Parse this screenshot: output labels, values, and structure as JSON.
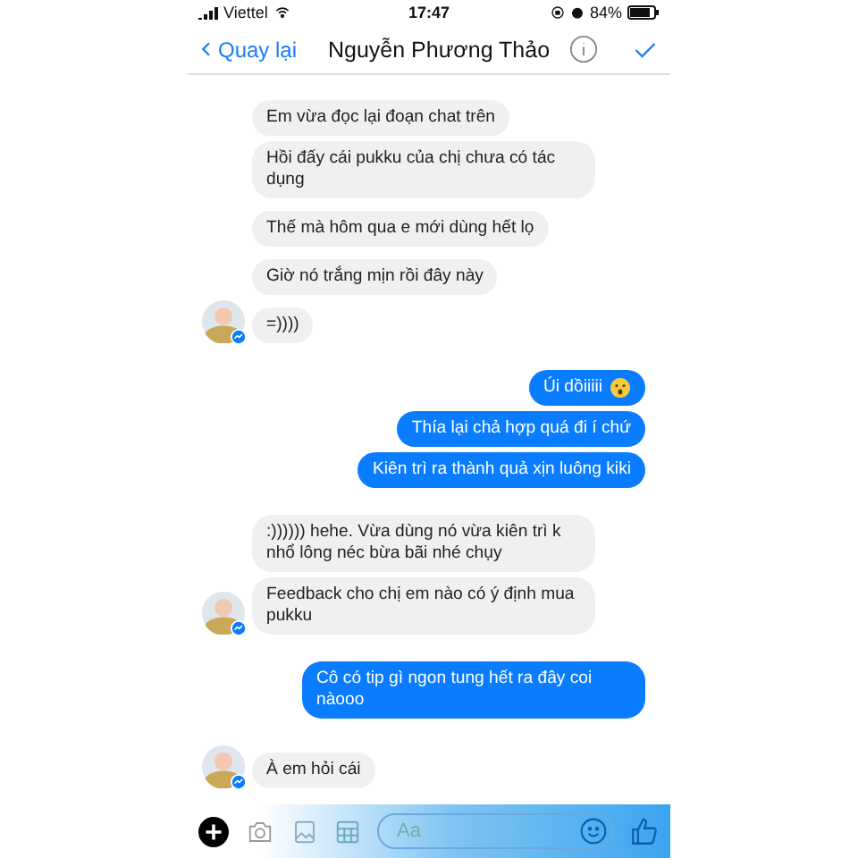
{
  "status_bar": {
    "carrier": "Viettel",
    "time": "17:47",
    "battery": "84%"
  },
  "nav": {
    "back": "Quay lại",
    "title": "Nguyễn Phương Thảo"
  },
  "messages": [
    {
      "kind": "incoming",
      "text": "Em vừa đọc lại đoạn chat trên",
      "avatar": false,
      "emoji": false
    },
    {
      "kind": "incoming",
      "text": "Hồi đấy cái pukku của chị chưa có tác dụng",
      "avatar": false,
      "emoji": false
    },
    {
      "kind": "incoming",
      "text": "Thế mà hôm qua e mới dùng hết lọ",
      "avatar": false,
      "emoji": false
    },
    {
      "kind": "incoming",
      "text": "Giờ nó trắng mịn rồi đây này",
      "avatar": false,
      "emoji": false
    },
    {
      "kind": "incoming",
      "text": "=))))",
      "avatar": true,
      "emoji": false
    },
    {
      "kind": "outgoing",
      "text": "Úi dồiiiii",
      "emoji": true
    },
    {
      "kind": "outgoing",
      "text": "Thía lại chả hợp quá đi í chứ",
      "emoji": false
    },
    {
      "kind": "outgoing",
      "text": "Kiên trì ra thành quả xịn luông kiki",
      "emoji": false
    },
    {
      "kind": "incoming",
      "text": ":)))))) hehe. Vừa dùng nó vừa kiên trì k nhổ lông néc bừa bãi nhé chụy",
      "avatar": false,
      "emoji": false
    },
    {
      "kind": "incoming",
      "text": "Feedback cho chị em nào có ý định mua pukku",
      "avatar": true,
      "emoji": false
    },
    {
      "kind": "outgoing",
      "text": "Cô có tip gì ngon tung hết ra đây coi nàooo",
      "emoji": false
    },
    {
      "kind": "incoming",
      "text": "À em hỏi cái",
      "avatar": true,
      "emoji": false
    }
  ],
  "composer": {
    "placeholder": "Aa"
  }
}
